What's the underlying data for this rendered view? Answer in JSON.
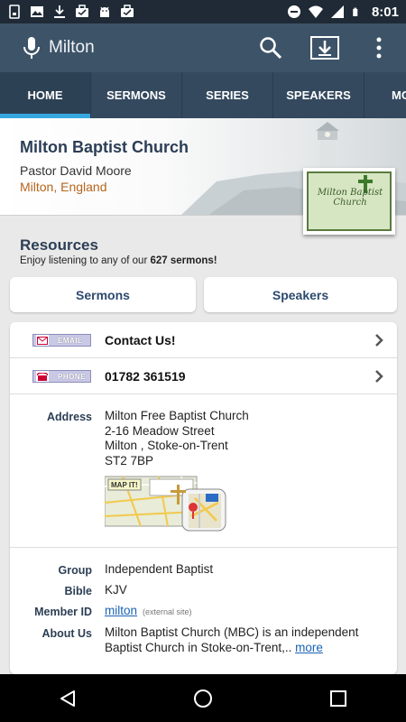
{
  "status_bar": {
    "time": "8:01",
    "left_icons": [
      "sim-icon",
      "gallery-icon",
      "download-icon",
      "briefcase-icon",
      "android-icon",
      "briefcase-icon"
    ],
    "right_icons": [
      "dnd-icon",
      "wifi-icon",
      "signal-icon",
      "battery-icon"
    ]
  },
  "app_bar": {
    "title": "Milton",
    "icons": [
      "mic-icon",
      "search-icon",
      "download-icon",
      "overflow-menu-icon"
    ]
  },
  "tabs": [
    {
      "label": "HOME",
      "active": true
    },
    {
      "label": "SERMONS",
      "active": false
    },
    {
      "label": "SERIES",
      "active": false
    },
    {
      "label": "SPEAKERS",
      "active": false
    },
    {
      "label": "MO",
      "active": false
    }
  ],
  "church": {
    "name": "Milton Baptist Church",
    "pastor": "Pastor David Moore",
    "location": "Milton, England",
    "logo_text": "Milton Baptist Church"
  },
  "resources": {
    "title": "Resources",
    "subtitle_prefix": "Enjoy listening to any of our ",
    "sermon_count": "627 sermons!",
    "buttons": {
      "sermons": "Sermons",
      "speakers": "Speakers"
    }
  },
  "contact": {
    "email_tag": "EMAIL",
    "email_label": "Contact Us!",
    "phone_tag": "PHONE",
    "phone_label": "01782 361519"
  },
  "details": {
    "address_label": "Address",
    "address_lines": [
      "Milton Free Baptist Church",
      "2-16 Meadow Street",
      "Milton , Stoke-on-Trent",
      "ST2 7BP"
    ],
    "map_label": "MAP IT!",
    "group_label": "Group",
    "group": "Independent Baptist",
    "bible_label": "Bible",
    "bible": "KJV",
    "member_label": "Member ID",
    "member_id": "milton",
    "member_ext": "(external site)",
    "about_label": "About Us",
    "about_line1": "Milton Baptist Church (MBC) is an independent",
    "about_line2": "Baptist Church in Stoke-on-Trent,..",
    "more": "more"
  },
  "colors": {
    "app_bar": "#3d5368",
    "tabs": "#34495e",
    "tab_indicator": "#36a8e0",
    "heading": "#2c3e55",
    "location": "#b5651d",
    "link": "#1a62b5"
  }
}
